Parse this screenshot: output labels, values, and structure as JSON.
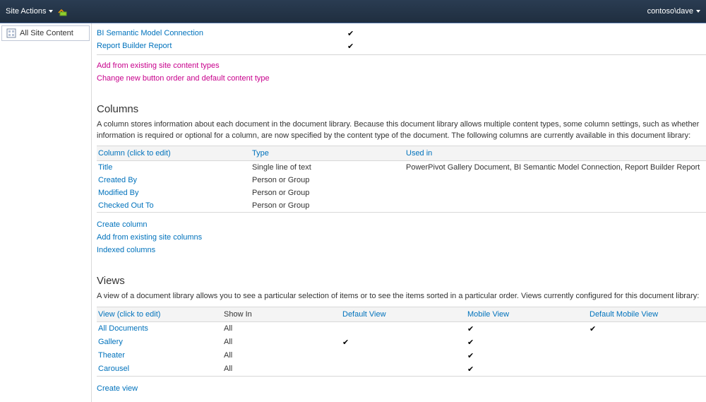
{
  "topbar": {
    "site_actions": "Site Actions",
    "user": "contoso\\dave"
  },
  "sidebar": {
    "all_site_content": "All Site Content"
  },
  "content_types": {
    "items": [
      {
        "name": "BI Semantic Model Connection",
        "checked": true
      },
      {
        "name": "Report Builder Report",
        "checked": true
      }
    ],
    "add_existing": "Add from existing site content types",
    "change_order": "Change new button order and default content type"
  },
  "columns_section": {
    "title": "Columns",
    "desc": "A column stores information about each document in the document library. Because this document library allows multiple content types, some column settings, such as whether information is required or optional for a column, are now specified by the content type of the document. The following columns are currently available in this document library:",
    "header": {
      "col": "Column (click to edit)",
      "type": "Type",
      "used": "Used in"
    },
    "rows": [
      {
        "name": "Title",
        "type": "Single line of text",
        "used": "PowerPivot Gallery Document, BI Semantic Model Connection, Report Builder Report"
      },
      {
        "name": "Created By",
        "type": "Person or Group",
        "used": ""
      },
      {
        "name": "Modified By",
        "type": "Person or Group",
        "used": ""
      },
      {
        "name": "Checked Out To",
        "type": "Person or Group",
        "used": ""
      }
    ],
    "actions": {
      "create": "Create column",
      "add": "Add from existing site columns",
      "indexed": "Indexed columns"
    }
  },
  "views_section": {
    "title": "Views",
    "desc": "A view of a document library allows you to see a particular selection of items or to see the items sorted in a particular order. Views currently configured for this document library:",
    "header": {
      "view": "View (click to edit)",
      "showin": "Show In",
      "default": "Default View",
      "mobile": "Mobile View",
      "defmobile": "Default Mobile View"
    },
    "rows": [
      {
        "name": "All Documents",
        "showin": "All",
        "default": false,
        "mobile": true,
        "defmobile": true
      },
      {
        "name": "Gallery",
        "showin": "All",
        "default": true,
        "mobile": true,
        "defmobile": false
      },
      {
        "name": "Theater",
        "showin": "All",
        "default": false,
        "mobile": true,
        "defmobile": false
      },
      {
        "name": "Carousel",
        "showin": "All",
        "default": false,
        "mobile": true,
        "defmobile": false
      }
    ],
    "create": "Create view"
  }
}
